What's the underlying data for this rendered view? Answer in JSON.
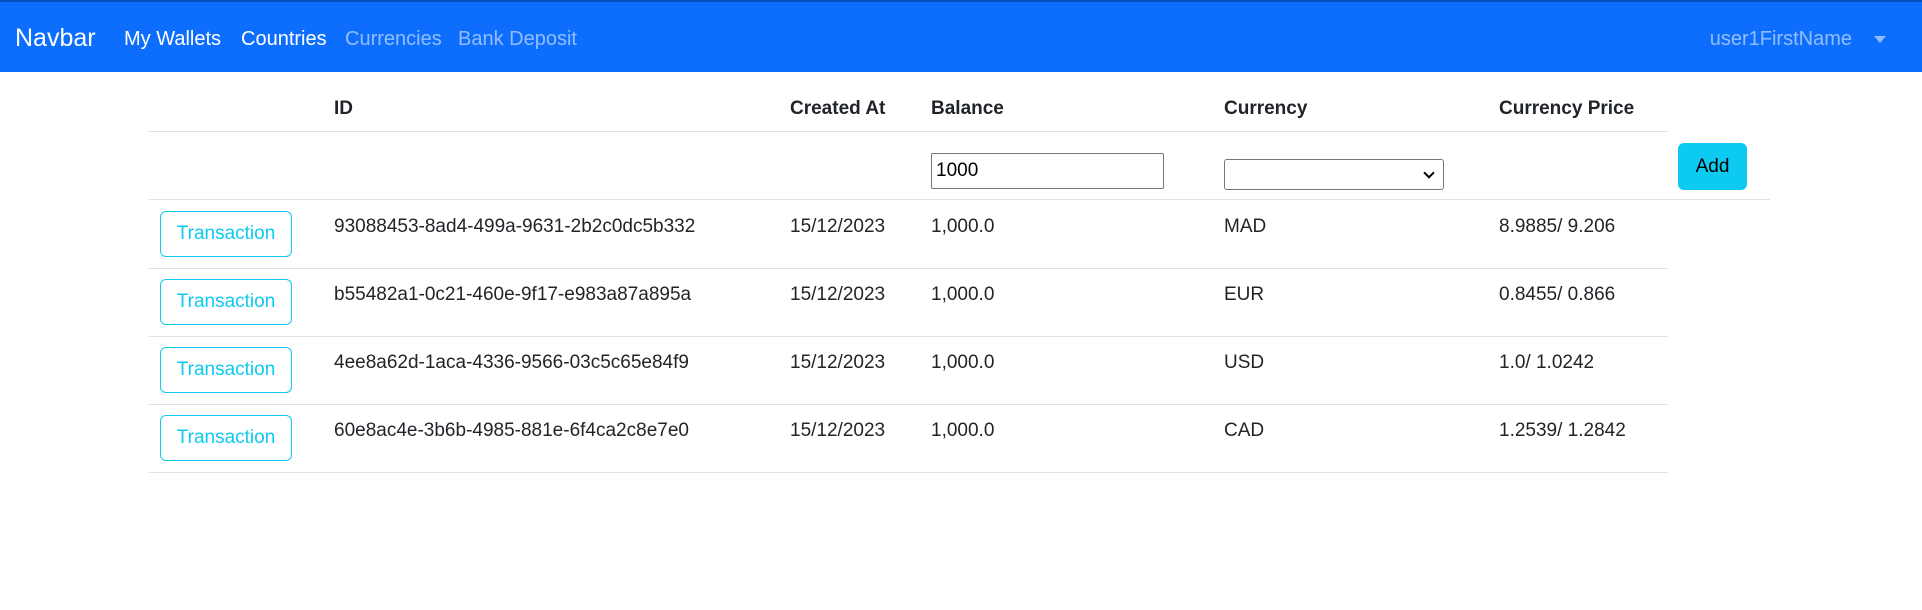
{
  "navbar": {
    "brand": "Navbar",
    "links": [
      {
        "label": "My Wallets",
        "active": true
      },
      {
        "label": "Countries",
        "active": true
      },
      {
        "label": "Currencies",
        "active": false
      },
      {
        "label": "Bank Deposit",
        "active": false
      }
    ],
    "user": "user1FirstName",
    "color": "#0d6efd"
  },
  "table": {
    "headers": [
      "",
      "ID",
      "Created At",
      "Balance",
      "Currency",
      "Currency Price"
    ],
    "form": {
      "balance_value": "1000",
      "currency_selected": "",
      "add_label": "Add"
    },
    "rows": [
      {
        "action": "Transaction",
        "id": "93088453-8ad4-499a-9631-2b2c0dc5b332",
        "created_at": "15/12/2023",
        "balance": "1,000.0",
        "currency": "MAD",
        "price": "8.9885/ 9.206"
      },
      {
        "action": "Transaction",
        "id": "b55482a1-0c21-460e-9f17-e983a87a895a",
        "created_at": "15/12/2023",
        "balance": "1,000.0",
        "currency": "EUR",
        "price": "0.8455/ 0.866"
      },
      {
        "action": "Transaction",
        "id": "4ee8a62d-1aca-4336-9566-03c5c65e84f9",
        "created_at": "15/12/2023",
        "balance": "1,000.0",
        "currency": "USD",
        "price": "1.0/ 1.0242"
      },
      {
        "action": "Transaction",
        "id": "60e8ac4e-3b6b-4985-881e-6f4ca2c8e7e0",
        "created_at": "15/12/2023",
        "balance": "1,000.0",
        "currency": "CAD",
        "price": "1.2539/ 1.2842"
      }
    ]
  },
  "colors": {
    "info": "#0dcaf0",
    "border": "#dee2e6"
  }
}
